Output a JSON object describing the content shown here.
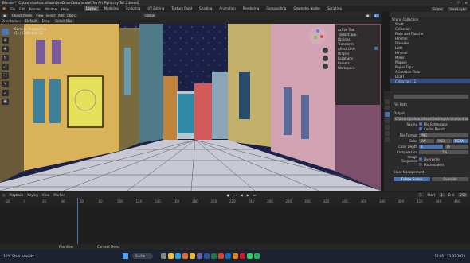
{
  "window": {
    "title": "Blender* [C:\\Users\\joshua.villaos\\OneDrive\\Dokumente\\The Art Fight.city Toll 2.blend]",
    "controls": [
      "–",
      "❐",
      "✕"
    ]
  },
  "menus": [
    "File",
    "Edit",
    "Render",
    "Window",
    "Help"
  ],
  "workspaces": [
    "Layout",
    "Modeling",
    "Sculpting",
    "UV Editing",
    "Texture Paint",
    "Shading",
    "Animation",
    "Rendering",
    "Compositing",
    "Geometry Nodes",
    "Scripting"
  ],
  "active_workspace": "Layout",
  "scene": {
    "label": "Scene",
    "view_layer": "ViewLayer"
  },
  "viewport": {
    "mode": "Object Mode",
    "menus": [
      "View",
      "Select",
      "Add",
      "Object"
    ],
    "orientation": "Global",
    "sub": [
      "Orientation:",
      "Default",
      "Drag:",
      "Select Box"
    ],
    "overlay_text": [
      "Camera Perspective",
      "(1) | Collection 12"
    ]
  },
  "npanel": {
    "active_tool": "Active Tool",
    "select_box": "Select Box",
    "options_header": "Options",
    "transform": "Transform",
    "orientation": "Default",
    "drag": "Select Box",
    "affect_only": "Affect Only",
    "origins": "Origins",
    "locations": "Locations",
    "parents": "Parents",
    "workspace": "Workspace",
    "tabs": [
      "Item",
      "Tool",
      "View"
    ]
  },
  "outliner": {
    "title": "Scene Collection",
    "items": [
      "Stadt",
      "Collection",
      "Plate und Flasche",
      "Himmel",
      "Dreiecke",
      "Licht",
      "Himmel",
      "Mirror",
      "Plappel",
      "Papier Figur",
      "Animation Tilde",
      "LICHT",
      "Collection 12"
    ]
  },
  "properties": {
    "search_placeholder": "",
    "file_path_label": "File Path",
    "output_header": "Output",
    "output_path": "C:\\Users\\joshua.villaos\\Desktop\\Animationtrial.mp4",
    "saving": "Saving",
    "file_extensions": "File Extensions",
    "cache_result": "Cache Result",
    "file_format_label": "File Format",
    "file_format": "PNG",
    "color_label": "Color",
    "color_opts": [
      "BW",
      "RGB",
      "RGBA"
    ],
    "color_depth_label": "Color Depth",
    "color_depth": [
      "8",
      "16"
    ],
    "compression_label": "Compression",
    "compression": "15%",
    "image_sequence": "Image Sequence",
    "overwrite": "Overwrite",
    "placeholders": "Placeholders",
    "color_management": "Color Management",
    "follow_scene": "Follow Scene",
    "override": "Override"
  },
  "timeline": {
    "menus": [
      "Playback",
      "Keying",
      "View",
      "Marker"
    ],
    "current_frame": "1",
    "start_label": "Start",
    "start": "1",
    "end_label": "End",
    "end": "250",
    "ticks": [
      "-20",
      "0",
      "20",
      "40",
      "60",
      "80",
      "100",
      "120",
      "140",
      "160",
      "180",
      "200",
      "220",
      "240",
      "260",
      "280",
      "300",
      "320",
      "340",
      "360",
      "380",
      "400",
      "420",
      "440",
      "460"
    ]
  },
  "statusbar": [
    "Pan View",
    "Context Menu"
  ],
  "taskbar": {
    "search": "Suche",
    "weather": "16°C Stark bewölkt",
    "time": "11:05",
    "date": "23.02.2023"
  },
  "colors": {
    "accent": "#4772b3",
    "sky": "#1b2146",
    "ground": "#c9c9d6"
  }
}
